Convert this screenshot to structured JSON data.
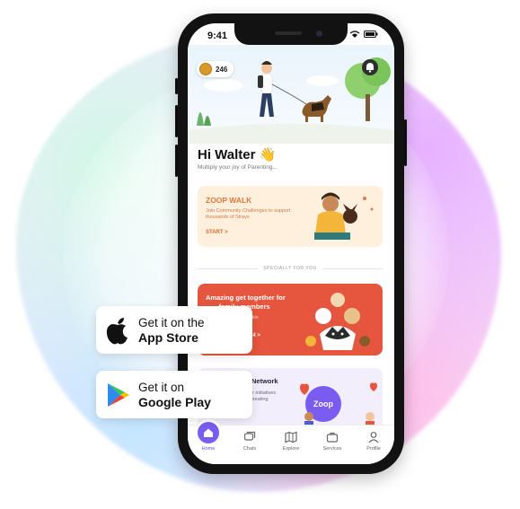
{
  "status_bar": {
    "time": "9:41"
  },
  "header": {
    "coins": "246"
  },
  "greeting": {
    "title": "Hi Walter 👋",
    "subtitle": "Multiply your joy of Parenting..."
  },
  "zoop_walk_card": {
    "title": "ZOOP WALK",
    "description": "Join Community Challenges to support thousands of Strays",
    "cta": "START >"
  },
  "section_divider": {
    "label": "SPECIALLY FOR YOU"
  },
  "event_card": {
    "title": "Amazing get together for\n       family members",
    "detail": "ckin",
    "cta": "24 >"
  },
  "network_card": {
    "title": "r Network",
    "description": "our initiatives\n& treating",
    "logo_text": "Zoop"
  },
  "tabbar": {
    "items": [
      {
        "label": "Home",
        "icon": "home-icon",
        "active": true
      },
      {
        "label": "Chats",
        "icon": "chats-icon",
        "active": false
      },
      {
        "label": "Explore",
        "icon": "map-icon",
        "active": false
      },
      {
        "label": "Services",
        "icon": "services-icon",
        "active": false
      },
      {
        "label": "Profile",
        "icon": "profile-icon",
        "active": false
      }
    ]
  },
  "store_badges": {
    "app_store": {
      "line1": "Get it on the",
      "line2": "App Store",
      "icon": "apple-icon"
    },
    "google_play": {
      "line1": "Get it on",
      "line2": "Google Play",
      "icon": "google-play-icon"
    }
  },
  "colors": {
    "accent": "#7a5cf0",
    "walk_card": "#fff0de",
    "event_card": "#e6553e",
    "network_card": "#f3eefb"
  }
}
